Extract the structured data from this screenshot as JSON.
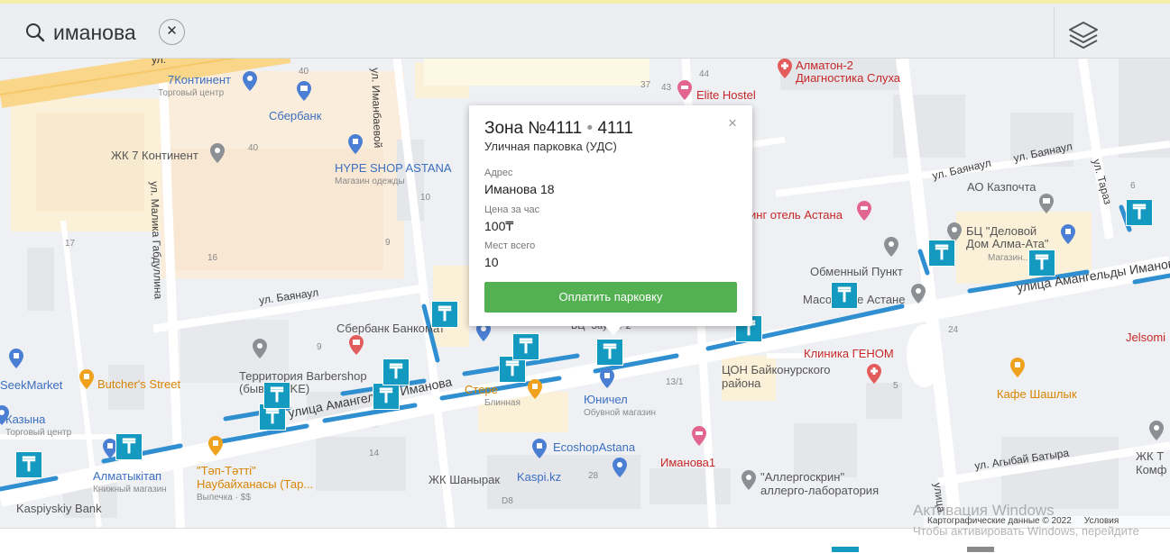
{
  "search": {
    "query": "иманова",
    "clear_glyph": "✕",
    "icon": "search-icon",
    "layers_icon": "layers-icon"
  },
  "popup": {
    "title": "Зона №4111",
    "separator": "•",
    "title_code": "4111",
    "subtitle": "Уличная парковка (УДС)",
    "address_caption": "Адрес",
    "address_value": "Иманова 18",
    "price_caption": "Цена за час",
    "price_value": "100₸",
    "spots_caption": "Мест всего",
    "spots_value": "10",
    "pay_button": "Оплатить парковку",
    "close_glyph": "×"
  },
  "map": {
    "parking_badge_glyph": "₸",
    "colors": {
      "parking_badge": "#149ac1",
      "parking_line": "#2f8fd0",
      "pay_button": "#53b151",
      "poi_blue": "#3b6fc1",
      "poi_red": "#c62828",
      "poi_orange": "#d88400"
    },
    "streets": {
      "bayanaul_top": "ул. Баянаул",
      "bayanaul_left": "ул. Баянаул",
      "bayanaul_right": "ул. Баянаул",
      "imanbaeva": "ул. Иманбаевой",
      "malika": "ул. Малика Габдуллина",
      "amangeldy_left": "улица Амангельды Иманова",
      "amangeldy_right": "улица Амангельды Иманова",
      "agybay": "ул. Агыбай Батыра",
      "taraz": "ул. Тараз",
      "top_ul": "ул.",
      "bottom_ulitsa": "улица"
    },
    "places": {
      "continent": "7Континент",
      "continent_sub": "Торговый центр",
      "sberbank_top": "Сбербанк",
      "zhk7": "ЖК 7 Континент",
      "hype": "HYPE SHOP ASTANA",
      "hype_sub": "Магазин одежды",
      "almaton": "Алматон-2",
      "almaton2": "Диагностика Слуха",
      "elite": "Elite Hostel",
      "hotel": "инг отель Астана",
      "kazpochta": "АО Казпочта",
      "bc1": "БЦ \"Деловой",
      "bc2": "Дом Алма-Ата\"",
      "bc_sub": "Магазин...",
      "obmen": "Обменный Пункт",
      "maso": "Масо",
      "astane": "е Астане",
      "sber_bank": "Сбербанк Банкомат",
      "bc_zaulet": "БЦ \"Заулет 2\"",
      "barber1": "Территория Barbershop",
      "barber2": "(бывш. LIKE)",
      "butchers": "Butcher's Street",
      "seek": "SeekMarket",
      "kazyna": "Казына",
      "kazyna_sub": "Торговый центр",
      "almatykitap": "Алматыкітап",
      "almatykitap_sub": "Книжный магазин",
      "kaspiy": "Kaspiyskiy Bank",
      "tep1": "\"Тәп-Тәтті\"",
      "tep2": "Наубайханасы (Тар...",
      "tep_sub": "Выпечка · $$",
      "blinnaya": "Блинная",
      "cherga": "Стере",
      "yunichel": "Юничел",
      "yunichel_sub": "Обувной магазин",
      "ecoshop": "EcoshopAstana",
      "kaspi": "Kaspi.kz",
      "zhk_shanyrak": "ЖК Шанырак",
      "imanova1": "Иманова1",
      "con1": "ЦОН Байконурского",
      "con2": "района",
      "genom": "Клиника ГЕНОМ",
      "kafe": "Кафе Шашлык",
      "jelsomi": "Jelsomi",
      "allergo1": "\"Аллергоскрин\"",
      "allergo2": "аллерго-лаборатория",
      "zhk_right1": "ЖК Т",
      "zhk_right2": "Комф"
    },
    "numbers": {
      "n40a": "40",
      "n40b": "40",
      "n37": "37",
      "n43": "43",
      "n44": "44",
      "n10": "10",
      "n9": "9",
      "n17": "17",
      "n16": "16",
      "n9b": "9",
      "n13": "13/1",
      "n28": "28",
      "n24": "24",
      "n14": "14",
      "n6": "6",
      "nd8": "D8",
      "n5": "5"
    }
  },
  "attribution": {
    "map_data": "Картографические данные © 2022",
    "terms": "Условия использова"
  },
  "windows_watermark": {
    "line1": "Активация Windows",
    "line2": "Чтобы активировать Windows, перейдите"
  }
}
